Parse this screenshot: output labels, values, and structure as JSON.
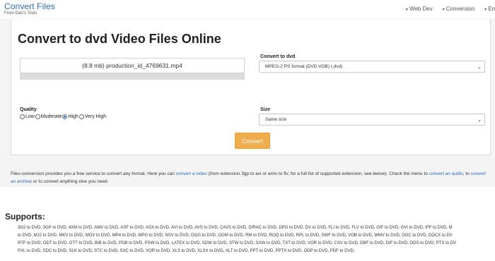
{
  "nav": {
    "brand_title": "Convert Files",
    "brand_sub": "From Dan's Tools",
    "links": [
      {
        "label": "Web Dev"
      },
      {
        "label": "Conversion"
      },
      {
        "label": "En"
      }
    ]
  },
  "convert": {
    "title": "Convert to dvd Video Files Online",
    "file_display": "(8.8 mb) production_id_4769631.mp4",
    "upload_progress": 1.0,
    "format_label": "Convert to dvd",
    "format_value": "MPEG-2 PS format (DVD VOB) (.dvd)",
    "quality_label": "Quality",
    "quality_options": [
      "Low",
      "Moderate",
      "High",
      "Very High"
    ],
    "quality_selected": "High",
    "size_label": "Size",
    "size_value": "Same size",
    "button_label": "Convert"
  },
  "info": {
    "part1": "Files-conversion provides you a free service to convert any format. Here you can ",
    "link1": "convert a video",
    "part2": " (from extension 3gp to avi or wmv to flv, for a full list of supported extension, see-below). Check the menu to ",
    "link2": "convert an audio",
    "part3": ", to ",
    "link3": "convert an archive",
    "part4": " or to convert anything else you need."
  },
  "supports": {
    "title": "Supports:",
    "lines": [
      "3G2 to DVD, 3GP to DVD, 4XM to DVD, AMV to DVD, ASF to DVD, ASX to DVD, AVI to DVD, AVS to DVD, CAVS to DVD, DIRAC to DVD, DPG to DVD, DV to DVD, FLI to DVD, FLV to DVD, GIF to DVD, GVI to DVD, IFF to DVD, M",
      "to DVD, MJ2 to DVD, MKV to DVD, MOV to DVD, MP4 to DVD, MPG to DVD, NSV to DVD, OGG to DVD, OGM to DVD, RM to DVD, ROQ to DVD, RPL to DVD, SWF to DVD, VOB to DVD, WMV to DVD, DOC to DVD, DOCX to DV",
      "RTF to DVD, ODT to DVD, OTT to DVD, BIB to DVD, PDB to DVD, PSW to DVD, LATEX to DVD, SDW to DVD, STW to DVD, SXW to DVD, TXT to DVD, VOR to DVD, CSV to DVD, DBF to DVD, DIF to DVD, ODS to DVD, PTS to DV",
      "PXL to DVD, SDC to DVD, SLK to DVD, STC to DVD, SXC to DVD, VOR to DVD, XLS to DVD, XLSX to DVD, XLT to DVD, PPT to DVD, PPTX to DVD, ODP to DVD, PDF to DVD,"
    ]
  }
}
